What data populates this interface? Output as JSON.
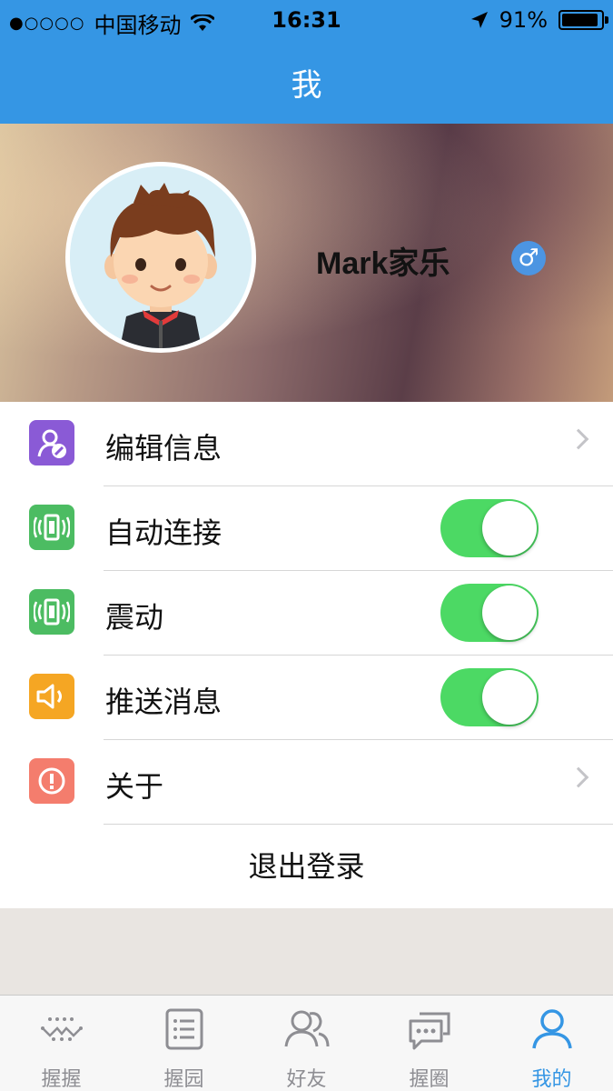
{
  "status_bar": {
    "signal": "●○○○○",
    "carrier": "中国移动",
    "time": "16:31",
    "battery_percent": "91%",
    "battery_level": 0.91
  },
  "nav": {
    "title": "我"
  },
  "profile": {
    "name": "Mark家乐",
    "gender_symbol": "♂"
  },
  "settings": [
    {
      "label": "编辑信息",
      "icon": "edit-profile-icon",
      "type": "link",
      "color": "#8a5ad6"
    },
    {
      "label": "自动连接",
      "icon": "vibrate-phone-icon",
      "type": "toggle",
      "on": true,
      "color": "#4cbc62"
    },
    {
      "label": "震动",
      "icon": "vibrate-phone-icon",
      "type": "toggle",
      "on": true,
      "color": "#4cbc62"
    },
    {
      "label": "推送消息",
      "icon": "speaker-icon",
      "type": "toggle",
      "on": true,
      "color": "#f5a623"
    },
    {
      "label": "关于",
      "icon": "info-icon",
      "type": "link",
      "color": "#f47d6d"
    }
  ],
  "logout_label": "退出登录",
  "tabs": [
    {
      "label": "握握",
      "icon": "dots-wave-icon",
      "active": false
    },
    {
      "label": "握园",
      "icon": "list-icon",
      "active": false
    },
    {
      "label": "好友",
      "icon": "friends-icon",
      "active": false
    },
    {
      "label": "握圈",
      "icon": "chat-bubbles-icon",
      "active": false
    },
    {
      "label": "我的",
      "icon": "person-icon",
      "active": true
    }
  ],
  "colors": {
    "nav_blue": "#3596e4",
    "toggle_green": "#4cd964",
    "tab_active": "#3596e4"
  }
}
